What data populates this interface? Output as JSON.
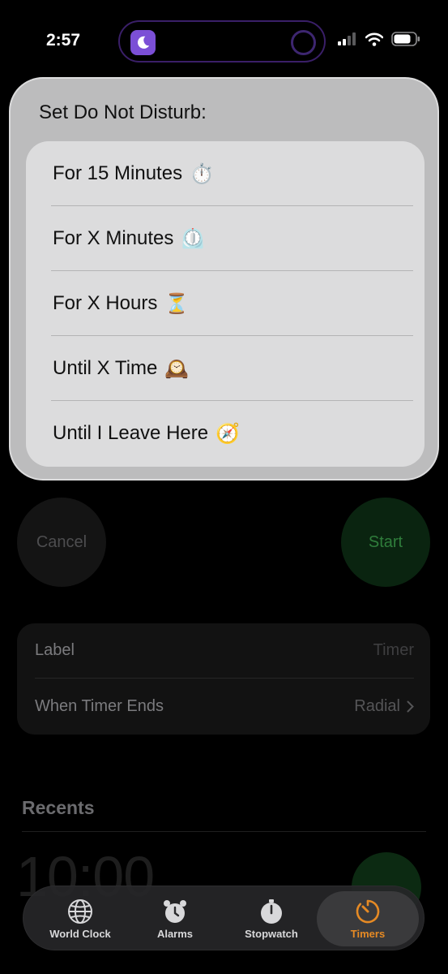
{
  "status": {
    "time": "2:57"
  },
  "popup": {
    "title": "Set Do Not Disturb:",
    "items": [
      {
        "label": "For 15 Minutes",
        "emoji": "⏱️"
      },
      {
        "label": "For X Minutes",
        "emoji": "⏲️"
      },
      {
        "label": "For X Hours",
        "emoji": "⏳"
      },
      {
        "label": "Until X Time",
        "emoji": "🕰️"
      },
      {
        "label": "Until I Leave Here",
        "emoji": "🧭"
      }
    ]
  },
  "timer": {
    "cancel_label": "Cancel",
    "start_label": "Start"
  },
  "settings": {
    "label_title": "Label",
    "label_value": "Timer",
    "sound_title": "When Timer Ends",
    "sound_value": "Radial"
  },
  "recents": {
    "title": "Recents",
    "first_time": "10:00"
  },
  "tabs": [
    {
      "label": "World Clock",
      "icon": "globe-icon"
    },
    {
      "label": "Alarms",
      "icon": "alarm-clock-icon"
    },
    {
      "label": "Stopwatch",
      "icon": "stopwatch-icon"
    },
    {
      "label": "Timers",
      "icon": "timer-icon"
    }
  ],
  "colors": {
    "accent": "#e68a24",
    "moon": "#7b4fd6",
    "start": "#2f7d3b"
  }
}
